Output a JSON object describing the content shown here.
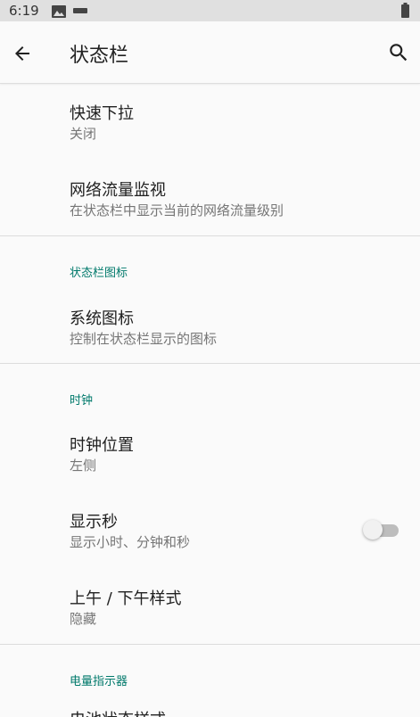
{
  "status_bar": {
    "time": "6:19"
  },
  "app_bar": {
    "title": "状态栏"
  },
  "items": [
    {
      "title": "快速下拉",
      "summary": "关闭"
    },
    {
      "title": "网络流量监视",
      "summary": "在状态栏中显示当前的网络流量级别"
    }
  ],
  "categories": {
    "statusbar_icons": {
      "label": "状态栏图标",
      "items": [
        {
          "title": "系统图标",
          "summary": "控制在状态栏显示的图标"
        }
      ]
    },
    "clock": {
      "label": "时钟",
      "items": [
        {
          "title": "时钟位置",
          "summary": "左侧"
        },
        {
          "title": "显示秒",
          "summary": "显示小时、分钟和秒",
          "toggle": false
        },
        {
          "title": "上午 / 下午样式",
          "summary": "隐藏"
        }
      ]
    },
    "battery": {
      "label": "电量指示器",
      "partial_item": "电池状态样式"
    }
  },
  "colors": {
    "accent": "#00796b",
    "background": "#fafafa",
    "status_bar": "#e0e0e0"
  },
  "icons": [
    "image-icon",
    "dash-icon",
    "battery-icon",
    "back-arrow-icon",
    "search-icon"
  ]
}
